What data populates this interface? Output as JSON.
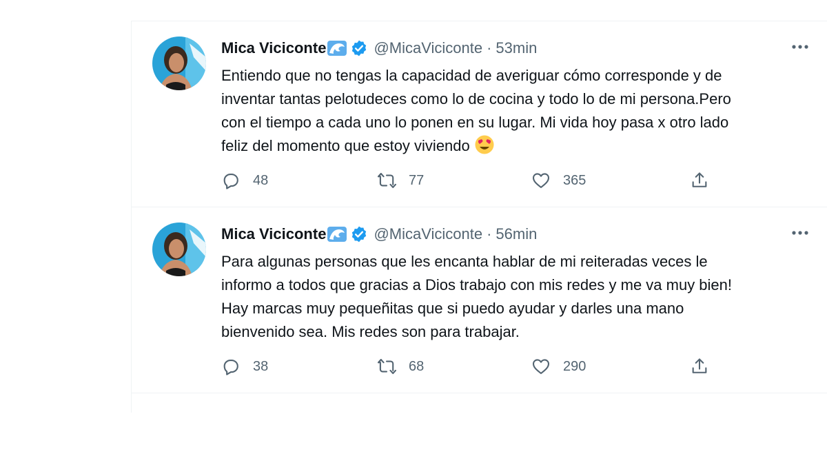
{
  "tweets": [
    {
      "author": "Mica Viciconte",
      "handle": "@MicaViciconte",
      "separator": "·",
      "time": "53min",
      "text": "Entiendo que no tengas la capacidad de averiguar cómo corresponde y de\ninventar tantas pelotudeces como lo de cocina y todo lo de mi persona.Pero\ncon el tiempo a cada uno lo ponen en su lugar. Mi vida hoy pasa x otro lado\nfeliz del momento que estoy viviendo",
      "emoji": "smiling-face-with-heart-eyes-icon",
      "replies": "48",
      "retweets": "77",
      "likes": "365"
    },
    {
      "author": "Mica Viciconte",
      "handle": "@MicaViciconte",
      "separator": "·",
      "time": "56min",
      "text": "Para algunas personas que les encanta hablar de mi reiteradas veces le\ninformo a todos que gracias a Dios trabajo con mis redes y me va muy bien!\nHay marcas muy pequeñitas que si puedo ayudar y darles una mano\nbienvenido sea. Mis redes son para trabajar.",
      "replies": "38",
      "retweets": "68",
      "likes": "290"
    }
  ],
  "icons": {
    "name_emoji": "water-wave-icon",
    "verified": "verified-badge-icon",
    "more": "more-icon",
    "reply": "reply-icon",
    "retweet": "retweet-icon",
    "like": "heart-icon",
    "share": "share-icon"
  },
  "colors": {
    "verified": "#1d9bf0",
    "text": "#0f1419",
    "secondary": "#536471",
    "divider": "#eff3f4"
  }
}
